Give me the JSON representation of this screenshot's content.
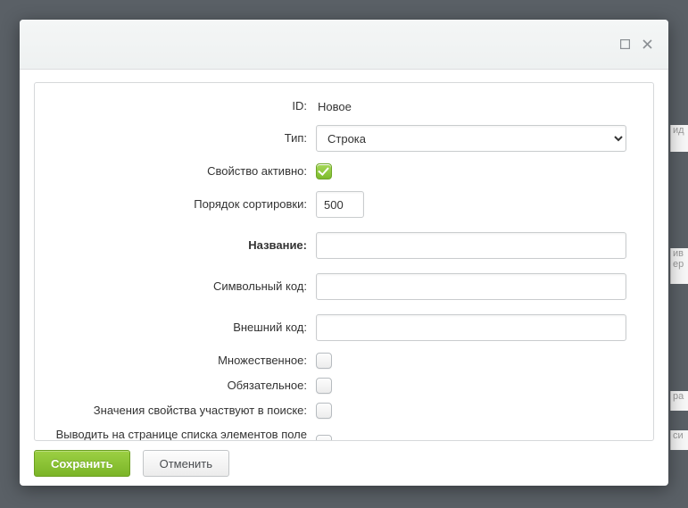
{
  "dialog": {
    "titlebar": {
      "maximize_icon": "maximize",
      "close_icon": "close"
    },
    "buttons": {
      "save": "Сохранить",
      "cancel": "Отменить"
    }
  },
  "form": {
    "id": {
      "label": "ID:",
      "value": "Новое"
    },
    "type": {
      "label": "Тип:",
      "value": "Строка"
    },
    "active": {
      "label": "Свойство активно:",
      "checked": true
    },
    "sort": {
      "label": "Порядок сортировки:",
      "value": "500"
    },
    "name": {
      "label": "Название:",
      "value": ""
    },
    "code": {
      "label": "Символьный код:",
      "value": ""
    },
    "external_code": {
      "label": "Внешний код:",
      "value": ""
    },
    "multiple": {
      "label": "Множественное:",
      "checked": false
    },
    "required": {
      "label": "Обязательное:",
      "checked": false
    },
    "searchable": {
      "label": "Значения свойства участвуют в поиске:",
      "checked": false
    },
    "filter_on_list": {
      "label": "Выводить на странице списка элементов поле для фильтрации по этому свойству:",
      "checked": false
    }
  }
}
